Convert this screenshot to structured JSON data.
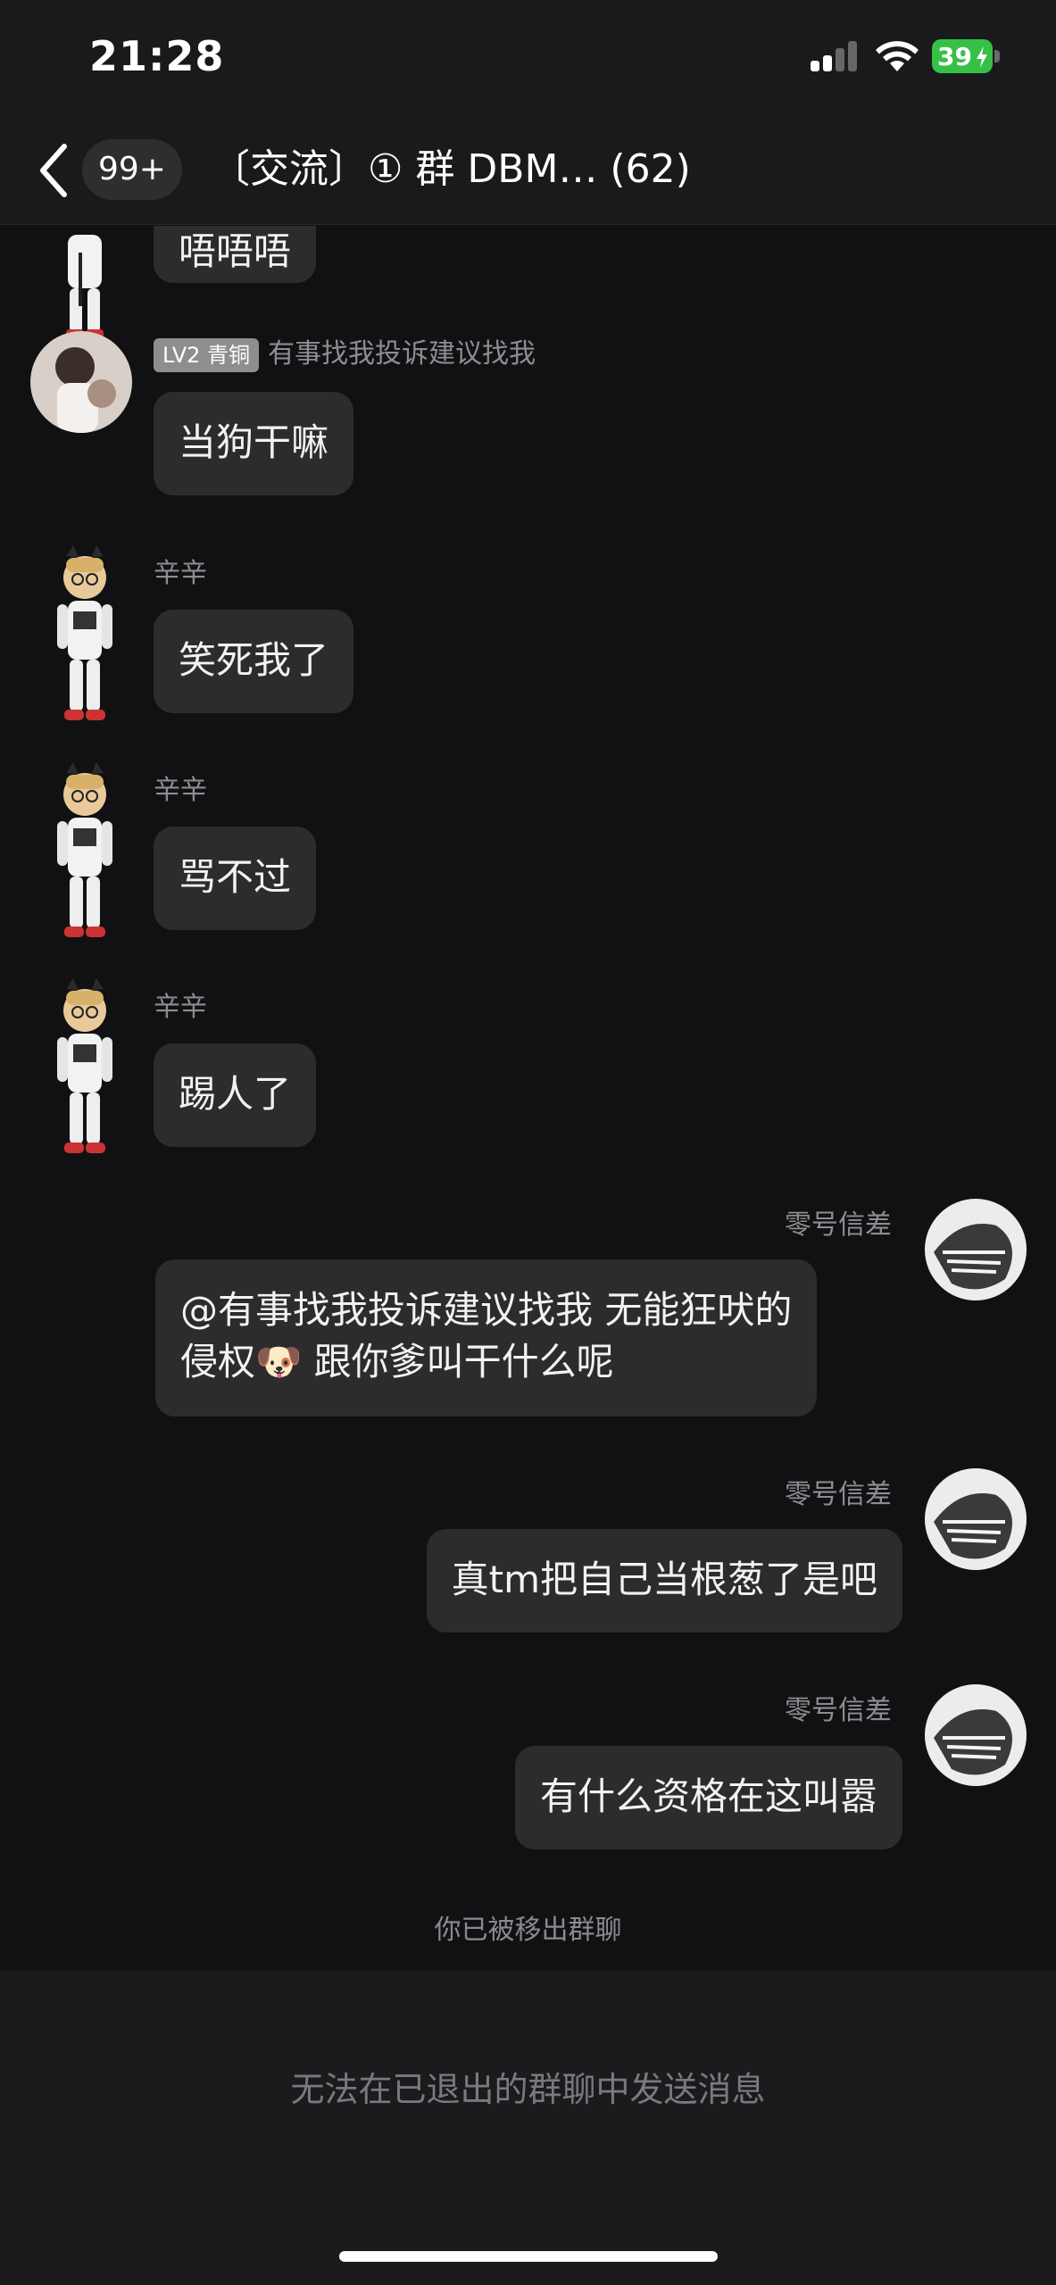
{
  "status_bar": {
    "time": "21:28",
    "battery": "39"
  },
  "header": {
    "back_label": "",
    "unread_badge": "99+",
    "title": "〔交流〕① 群 DBM…  (62)"
  },
  "messages": [
    {
      "side": "left",
      "sender": "",
      "text": "唔唔唔"
    },
    {
      "side": "left",
      "level": "LV2 青铜",
      "sender": "有事找我投诉建议找我",
      "text": "当狗干嘛"
    },
    {
      "side": "left",
      "sender": "辛辛",
      "text": "笑死我了"
    },
    {
      "side": "left",
      "sender": "辛辛",
      "text": "骂不过"
    },
    {
      "side": "left",
      "sender": "辛辛",
      "text": "踢人了"
    },
    {
      "side": "right",
      "sender": "零号信差",
      "text_line1": "@有事找我投诉建议找我 无能狂吠的",
      "text_line2": "侵权🐶 跟你爹叫干什么呢"
    },
    {
      "side": "right",
      "sender": "零号信差",
      "text": "真tm把自己当根葱了是吧"
    },
    {
      "side": "right",
      "sender": "零号信差",
      "text": "有什么资格在这叫嚣"
    }
  ],
  "system_notice": "你已被移出群聊",
  "input_bar": {
    "disabled_text": "无法在已退出的群聊中发送消息"
  },
  "colors": {
    "background": "#111113",
    "bubble": "#2c2c2e",
    "battery": "#36c048",
    "secondary_text": "#8e8e92"
  },
  "icons": [
    "signal-icon",
    "wifi-icon",
    "battery-icon",
    "back-icon",
    "chibi-avatar-icon",
    "photo-avatar-icon"
  ]
}
